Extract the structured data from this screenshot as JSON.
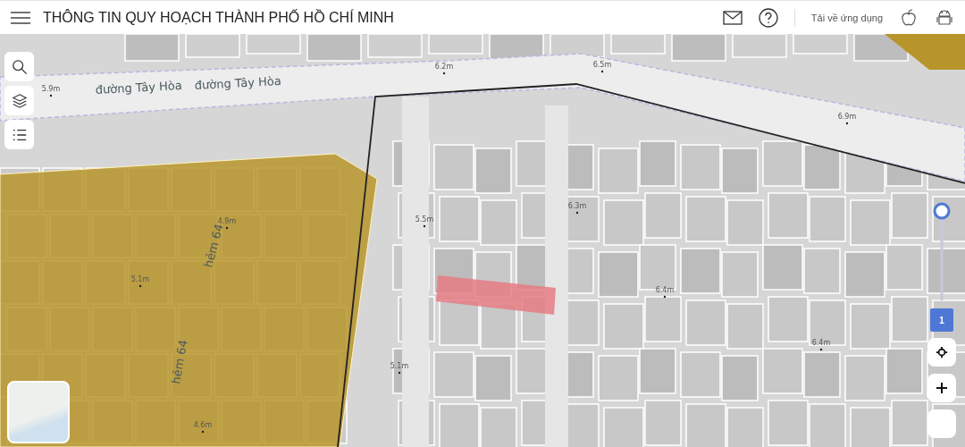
{
  "header": {
    "title": "THÔNG TIN QUY HOẠCH THÀNH PHỐ HỒ CHÍ MINH",
    "download_label": "Tải về ứng dụng"
  },
  "map": {
    "street_labels": [
      "đường Tây Hòa",
      "đường Tây Hòa",
      "hẻm 64",
      "hẻm 64"
    ],
    "elevation_labels": [
      "5.9m",
      "6.2m",
      "6.5m",
      "6.9m",
      "5.5m",
      "6.3m",
      "4.9m",
      "5.1m",
      "5.1m",
      "6.4m",
      "6.4m",
      "4.6m"
    ]
  },
  "zoom_badge": "1"
}
